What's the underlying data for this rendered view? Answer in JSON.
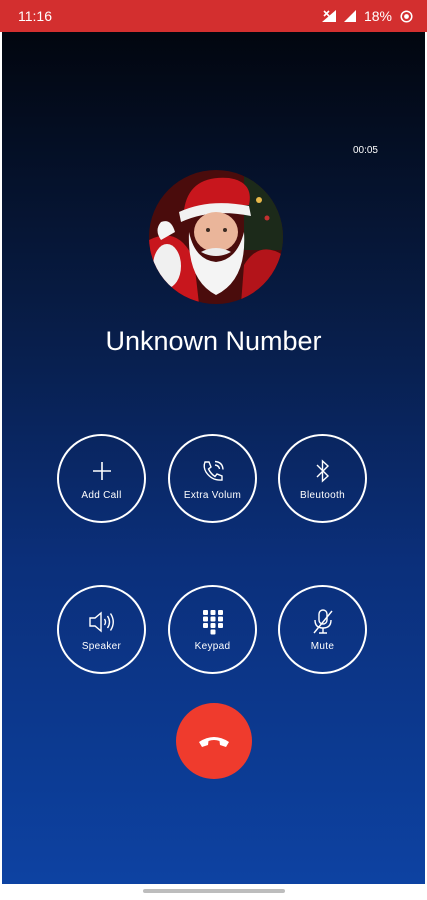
{
  "status_bar": {
    "time": "11:16",
    "battery_percent": "18%",
    "color": "#d32f2f"
  },
  "call": {
    "timer": "00:05",
    "caller_name": "Unknown Number"
  },
  "controls": [
    {
      "label": "Add Call",
      "icon": "plus-icon"
    },
    {
      "label": "Extra Volum",
      "icon": "phone-volume-icon"
    },
    {
      "label": "Bleutooth",
      "icon": "bluetooth-icon"
    },
    {
      "label": "Speaker",
      "icon": "speaker-icon"
    },
    {
      "label": "Keypad",
      "icon": "keypad-icon"
    },
    {
      "label": "Mute",
      "icon": "mic-off-icon"
    }
  ],
  "end_call": {
    "icon": "hang-up-icon",
    "color": "#ef3b2d"
  },
  "colors": {
    "gradient_top": "#02060f",
    "gradient_bottom": "#0d42a2"
  }
}
